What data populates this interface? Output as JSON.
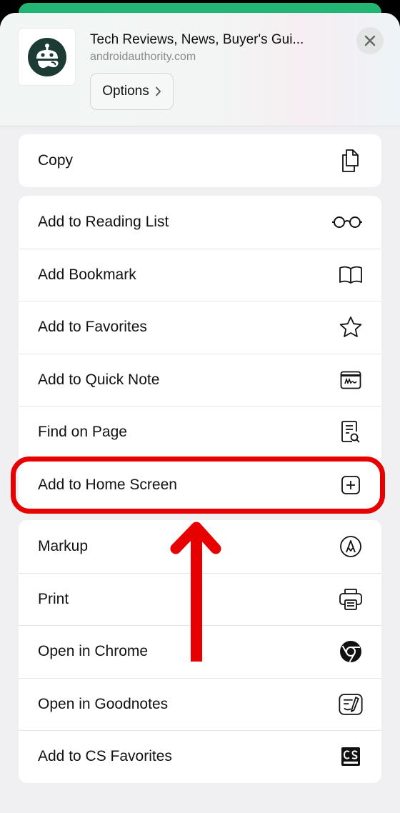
{
  "header": {
    "title": "Tech Reviews, News, Buyer's Gui...",
    "url": "androidauthority.com",
    "options_label": "Options",
    "close_icon": "close-icon",
    "app_icon": "android-authority-logo"
  },
  "groups": [
    {
      "items": [
        {
          "label": "Copy",
          "icon": "copy-icon"
        }
      ]
    },
    {
      "items": [
        {
          "label": "Add to Reading List",
          "icon": "glasses-icon"
        },
        {
          "label": "Add Bookmark",
          "icon": "book-icon"
        },
        {
          "label": "Add to Favorites",
          "icon": "star-icon"
        },
        {
          "label": "Add to Quick Note",
          "icon": "quick-note-icon"
        },
        {
          "label": "Find on Page",
          "icon": "find-on-page-icon"
        },
        {
          "label": "Add to Home Screen",
          "icon": "plus-square-icon",
          "highlighted": true
        }
      ]
    },
    {
      "items": [
        {
          "label": "Markup",
          "icon": "markup-icon"
        },
        {
          "label": "Print",
          "icon": "printer-icon"
        },
        {
          "label": "Open in Chrome",
          "icon": "chrome-icon"
        },
        {
          "label": "Open in Goodnotes",
          "icon": "goodnotes-icon"
        },
        {
          "label": "Add to CS Favorites",
          "icon": "cs-icon"
        }
      ]
    }
  ],
  "colors": {
    "highlight": "#e60000",
    "top_strip": "#22b573",
    "sheet_background": "#f0f0f2",
    "logo": "#1c3b34"
  }
}
